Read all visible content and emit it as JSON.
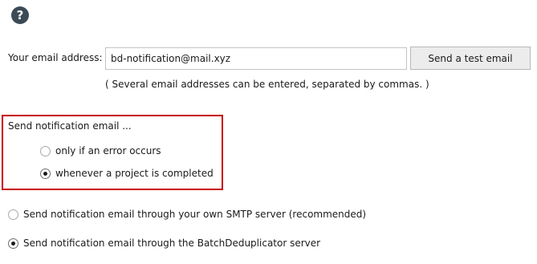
{
  "help": {
    "glyph": "?"
  },
  "email": {
    "label": "Your email address:",
    "value": "bd-notification@mail.xyz",
    "test_button": "Send a test email",
    "hint": "( Several email addresses can be entered, separated by commas. )"
  },
  "notify": {
    "title": "Send notification email ...",
    "options": [
      {
        "label": "only if an error occurs",
        "checked": false
      },
      {
        "label": "whenever a project is completed",
        "checked": true
      }
    ]
  },
  "server": {
    "options": [
      {
        "label": "Send notification email through your own SMTP server (recommended)",
        "checked": false
      },
      {
        "label": "Send notification email through the BatchDeduplicator server",
        "checked": true
      }
    ]
  },
  "colors": {
    "highlight_border": "#c80000",
    "help_icon_bg": "#3c4a57"
  }
}
